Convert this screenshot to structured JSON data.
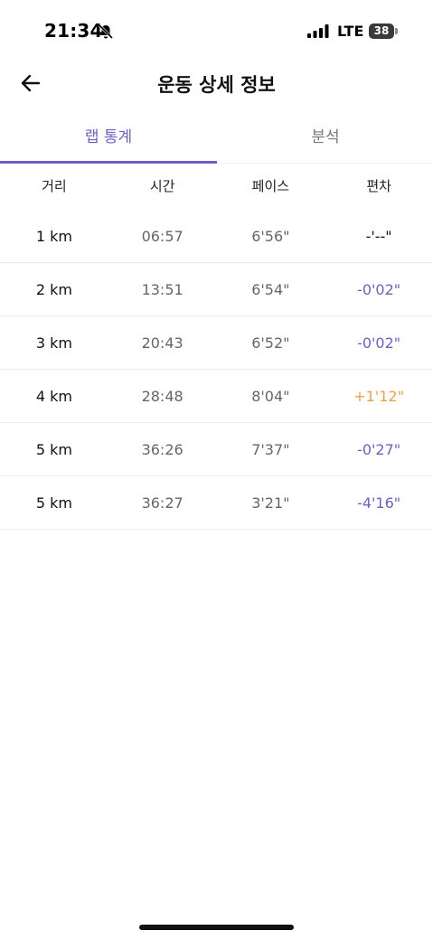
{
  "status_bar": {
    "time": "21:34",
    "network": "LTE",
    "battery": "38"
  },
  "header": {
    "title": "운동 상세 정보"
  },
  "tabs": [
    {
      "label": "랩 통계",
      "active": true
    },
    {
      "label": "분석",
      "active": false
    }
  ],
  "table": {
    "columns": [
      "거리",
      "시간",
      "페이스",
      "편차"
    ],
    "rows": [
      {
        "distance": "1 km",
        "time": "06:57",
        "pace": "6'56\"",
        "deviation": "-'--\"",
        "deviation_type": "neutral"
      },
      {
        "distance": "2 km",
        "time": "13:51",
        "pace": "6'54\"",
        "deviation": "-0'02\"",
        "deviation_type": "negative"
      },
      {
        "distance": "3 km",
        "time": "20:43",
        "pace": "6'52\"",
        "deviation": "-0'02\"",
        "deviation_type": "negative"
      },
      {
        "distance": "4 km",
        "time": "28:48",
        "pace": "8'04\"",
        "deviation": "+1'12\"",
        "deviation_type": "positive"
      },
      {
        "distance": "5 km",
        "time": "36:26",
        "pace": "7'37\"",
        "deviation": "-0'27\"",
        "deviation_type": "negative"
      },
      {
        "distance": "5 km",
        "time": "36:27",
        "pace": "3'21\"",
        "deviation": "-4'16\"",
        "deviation_type": "negative"
      }
    ]
  },
  "colors": {
    "accent": "#6c5fc7",
    "positive_deviation": "#f0a23a",
    "divider": "#ececef"
  },
  "icons": {
    "back": "arrow-left-icon",
    "bell": "bell-slash-icon",
    "signal": "cellular-signal-icon"
  }
}
